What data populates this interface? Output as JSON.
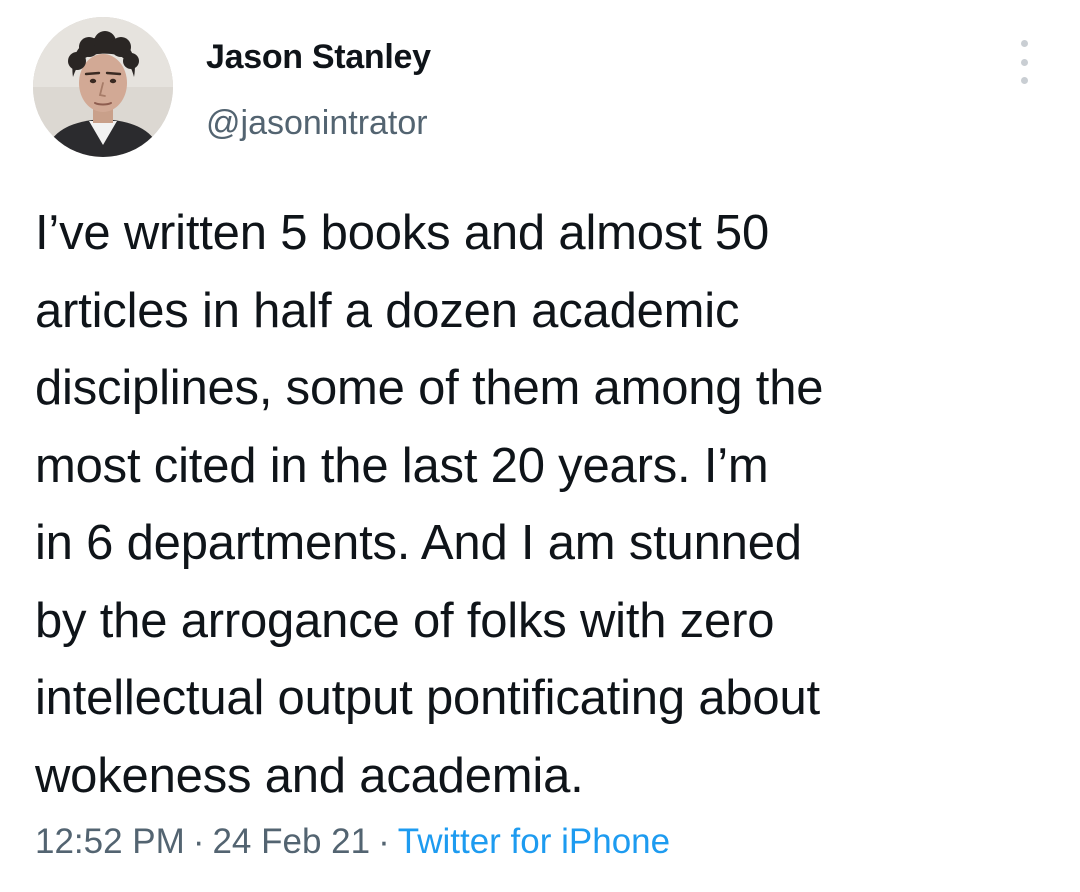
{
  "user": {
    "display_name": "Jason Stanley",
    "handle": "@jasonintrator",
    "avatar_icon": "profile-photo"
  },
  "more_icon": "more-vertical-icon",
  "tweet": {
    "lines": [
      "I’ve written 5 books and almost 50",
      "articles in half a dozen academic",
      "disciplines, some of them among the",
      "most cited in the last 20 years. I’m",
      "in 6 departments. And I am stunned",
      "by the arrogance of folks with zero",
      "intellectual output pontificating about",
      "wokeness and academia."
    ]
  },
  "meta": {
    "time": "12:52 PM",
    "date": "24 Feb 21",
    "separator": "·",
    "source": "Twitter for iPhone"
  },
  "colors": {
    "text": "#0f1419",
    "secondary": "#536471",
    "link": "#1d9bf0"
  }
}
